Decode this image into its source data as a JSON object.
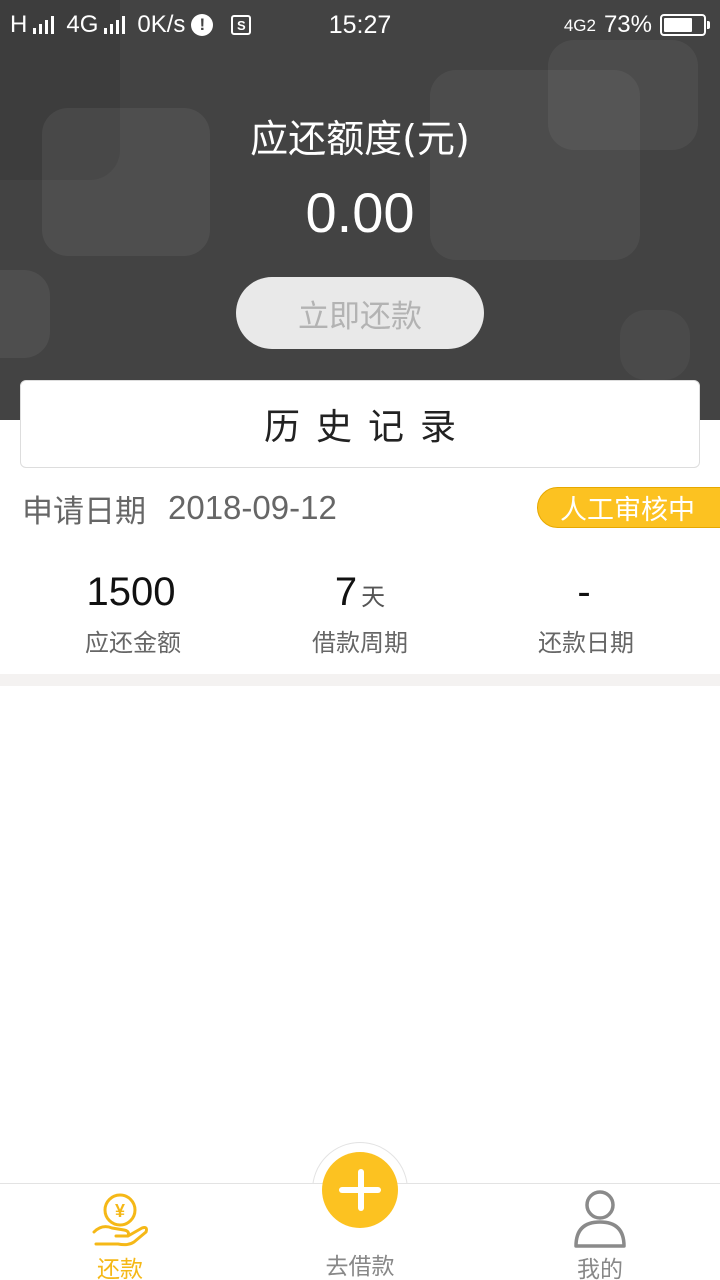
{
  "status_bar": {
    "sim1": "H",
    "sim2": "4G",
    "speed": "0K/s",
    "time": "15:27",
    "network": "4G2",
    "battery": "73%",
    "battery_level": 0.73
  },
  "summary": {
    "label": "应还额度(元)",
    "amount": "0.00",
    "repay_button": "立即还款"
  },
  "history": {
    "label": "历史记录"
  },
  "application": {
    "date_label": "申请日期",
    "date": "2018-09-12",
    "status": "人工审核中"
  },
  "stats": [
    {
      "value": "1500",
      "unit": "",
      "label": "应还金额"
    },
    {
      "value": "7",
      "unit": "天",
      "label": "借款周期"
    },
    {
      "value": "-",
      "unit": "",
      "label": "还款日期"
    }
  ],
  "nav": {
    "repay": "还款",
    "borrow": "去借款",
    "mine": "我的"
  },
  "colors": {
    "accent": "#fcc221",
    "header_bg": "#434343"
  },
  "icons": {
    "repay": "hand-yen-icon",
    "borrow": "plus-icon",
    "mine": "user-icon"
  }
}
